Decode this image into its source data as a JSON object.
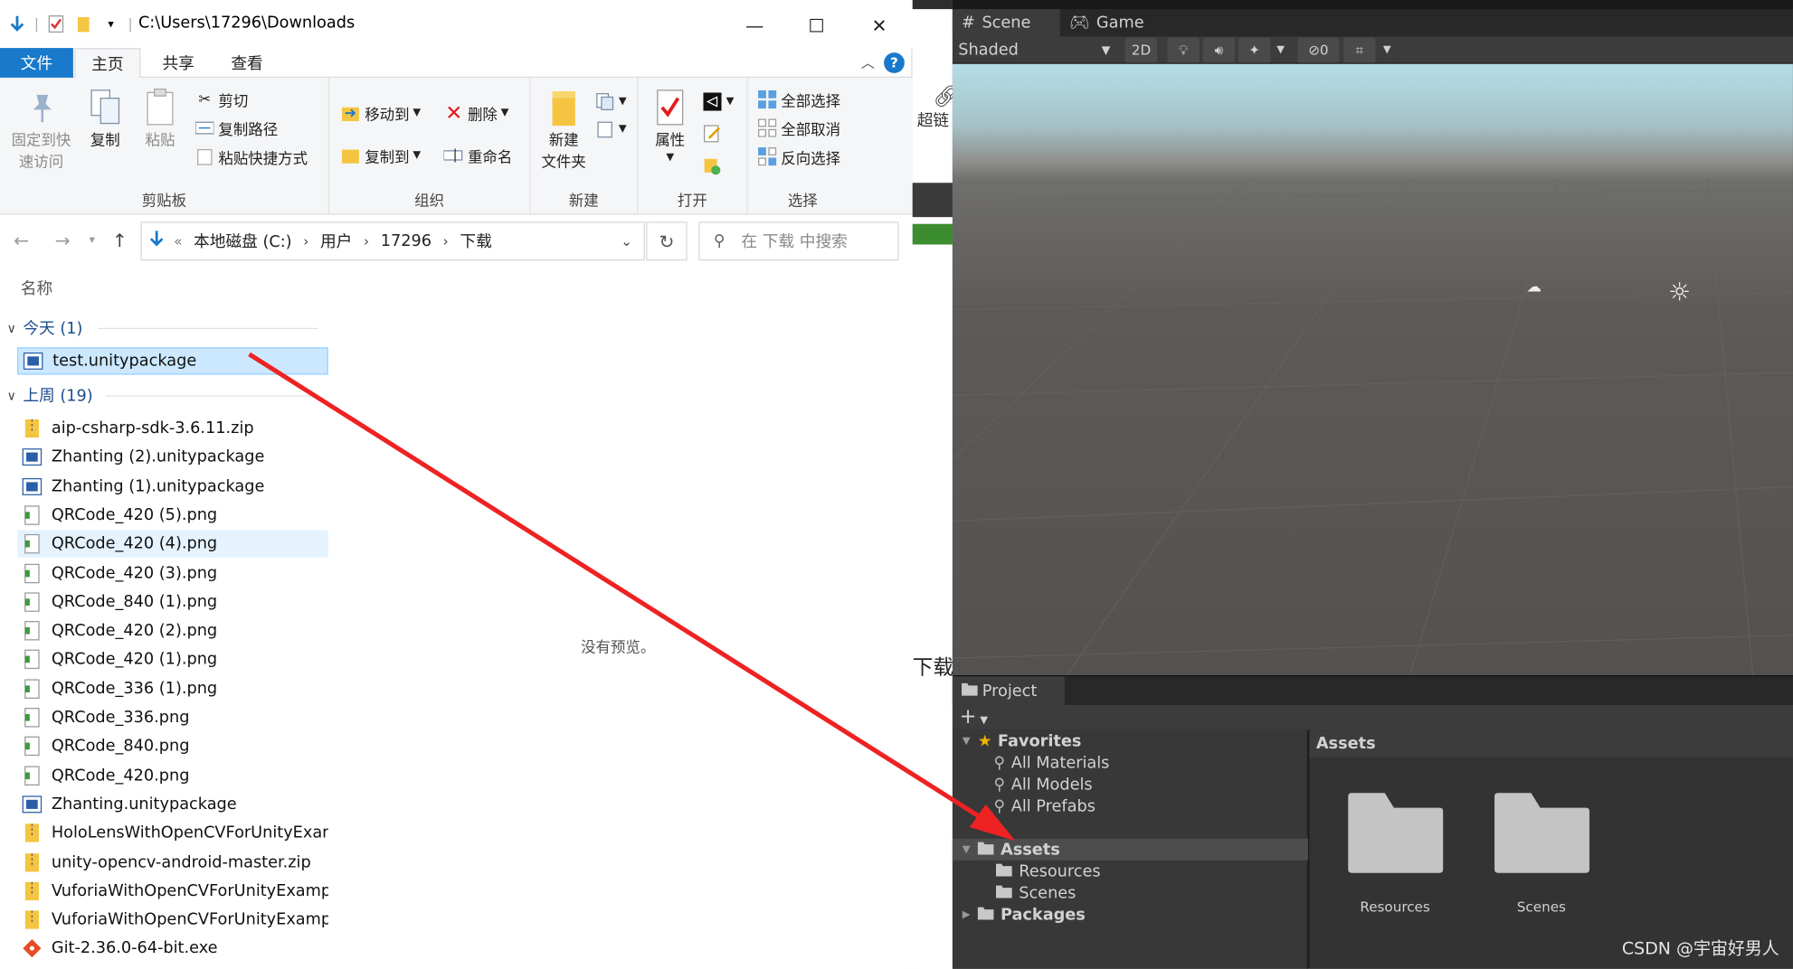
{
  "explorer": {
    "title_path": "C:\\Users\\17296\\Downloads",
    "window_controls": {
      "minimize": "—",
      "maximize": "☐",
      "close": "✕"
    },
    "ribbon_tabs": {
      "file": "文件",
      "home": "主页",
      "share": "共享",
      "view": "查看"
    },
    "help": "?",
    "ribbon": {
      "clipboard": {
        "pin_line1": "固定到快",
        "pin_line2": "速访问",
        "copy": "复制",
        "paste": "粘贴",
        "cut": "剪切",
        "copy_path": "复制路径",
        "paste_shortcut": "粘贴快捷方式",
        "label": "剪贴板"
      },
      "organize": {
        "move_to": "移动到",
        "copy_to": "复制到",
        "delete": "删除",
        "rename": "重命名",
        "label": "组织"
      },
      "new": {
        "new_folder_line1": "新建",
        "new_folder_line2": "文件夹",
        "label": "新建"
      },
      "open": {
        "properties": "属性",
        "label": "打开"
      },
      "select": {
        "select_all": "全部选择",
        "select_none": "全部取消",
        "invert": "反向选择",
        "label": "选择"
      }
    },
    "address": {
      "crumbs": [
        "本地磁盘 (C:)",
        "用户",
        "17296",
        "下载"
      ],
      "prefix": "«"
    },
    "search_placeholder": "在 下载 中搜索",
    "column_name": "名称",
    "groups": {
      "today": "今天 (1)",
      "last_week": "上周 (19)"
    },
    "today_files": [
      {
        "name": "test.unitypackage",
        "type": "unitypackage"
      }
    ],
    "week_files": [
      {
        "name": "aip-csharp-sdk-3.6.11.zip",
        "type": "zip"
      },
      {
        "name": "Zhanting (2).unitypackage",
        "type": "unitypackage"
      },
      {
        "name": "Zhanting (1).unitypackage",
        "type": "unitypackage"
      },
      {
        "name": "QRCode_420 (5).png",
        "type": "png"
      },
      {
        "name": "QRCode_420 (4).png",
        "type": "png"
      },
      {
        "name": "QRCode_420 (3).png",
        "type": "png"
      },
      {
        "name": "QRCode_840 (1).png",
        "type": "png"
      },
      {
        "name": "QRCode_420 (2).png",
        "type": "png"
      },
      {
        "name": "QRCode_420 (1).png",
        "type": "png"
      },
      {
        "name": "QRCode_336 (1).png",
        "type": "png"
      },
      {
        "name": "QRCode_336.png",
        "type": "png"
      },
      {
        "name": "QRCode_840.png",
        "type": "png"
      },
      {
        "name": "QRCode_420.png",
        "type": "png"
      },
      {
        "name": "Zhanting.unitypackage",
        "type": "unitypackage"
      },
      {
        "name": "HoloLensWithOpenCVForUnityExam",
        "type": "zip"
      },
      {
        "name": "unity-opencv-android-master.zip",
        "type": "zip"
      },
      {
        "name": "VuforiaWithOpenCVForUnityExamp",
        "type": "zip"
      },
      {
        "name": "VuforiaWithOpenCVForUnityExamp",
        "type": "zip"
      },
      {
        "name": "Git-2.36.0-64-bit.exe",
        "type": "exe"
      }
    ],
    "preview_text": "没有预览。"
  },
  "background": {
    "link_text": "超链",
    "download_text": "下载"
  },
  "unity": {
    "tabs": {
      "scene": "Scene",
      "game": "Game"
    },
    "toolbar": {
      "shading": "Shaded",
      "mode_2d": "2D",
      "hidden_count": "0"
    },
    "project_tab": "Project",
    "tree": {
      "favorites": "Favorites",
      "favorite_items": [
        "All Materials",
        "All Models",
        "All Prefabs"
      ],
      "assets": "Assets",
      "asset_children": [
        "Resources",
        "Scenes"
      ],
      "packages": "Packages"
    },
    "assets_header": "Assets",
    "asset_folders": [
      "Resources",
      "Scenes"
    ],
    "watermark": "CSDN @宇宙好男人"
  },
  "colors": {
    "accent": "#1979ca",
    "selection": "#cce8ff",
    "arrow": "#ee2222",
    "unity_dark": "#383838"
  }
}
